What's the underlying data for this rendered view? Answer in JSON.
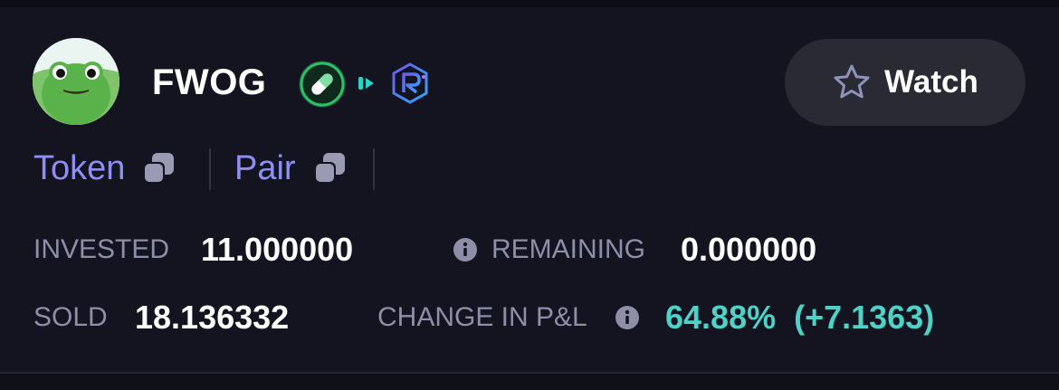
{
  "token": {
    "name": "FWOG",
    "avatar_icon": "frog-avatar-icon",
    "badges": [
      "pill-icon",
      "play-indicator-icon",
      "raydium-icon"
    ]
  },
  "watch_button": {
    "label": "Watch",
    "icon": "star-outline-icon"
  },
  "links": [
    {
      "label": "Token",
      "icon": "copy-icon"
    },
    {
      "label": "Pair",
      "icon": "copy-icon"
    }
  ],
  "stats": {
    "invested": {
      "label": "INVESTED",
      "value": "11.000000"
    },
    "remaining": {
      "label": "REMAINING",
      "value": "0.000000",
      "icon": "info-icon"
    },
    "sold": {
      "label": "SOLD",
      "value": "18.136332"
    },
    "change_pnl": {
      "label": "CHANGE IN P&L",
      "value": "64.88%  (+7.1363)",
      "icon": "info-icon"
    }
  },
  "colors": {
    "background": "#141420",
    "link": "#8f8ef2",
    "muted_label": "#8e8ea8",
    "positive": "#4fd1c5",
    "button_bg": "#2a2a34"
  }
}
